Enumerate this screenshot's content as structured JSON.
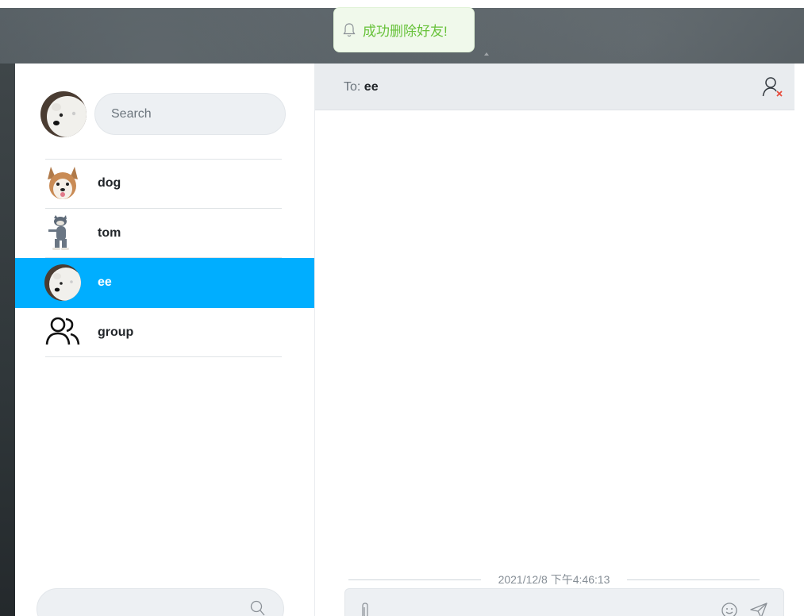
{
  "toast": {
    "message": "成功删除好友!",
    "icon": "bell-icon",
    "color": "#67c23a"
  },
  "sidebar": {
    "search": {
      "placeholder": "Search"
    },
    "contacts": [
      {
        "name": "dog",
        "avatar": "husky-dog-avatar",
        "active": false
      },
      {
        "name": "tom",
        "avatar": "tom-cat-avatar",
        "active": false
      },
      {
        "name": "ee",
        "avatar": "ice-bear-avatar",
        "active": true
      },
      {
        "name": "group",
        "avatar": "group-icon",
        "active": false
      }
    ],
    "bottom_search_icon": "search-icon"
  },
  "chat": {
    "to_label": "To: ",
    "recipient": "ee",
    "remove_friend_icon": "remove-user-icon",
    "timestamp": "2021/12/8 下午4:46:13",
    "composer_icons": [
      "paperclip-icon",
      "emoji-icon",
      "send-icon"
    ]
  },
  "colors": {
    "active_contact": "#00aeff",
    "header_bg": "#e9ecef",
    "input_bg": "#edf0f3",
    "remove_x": "#e74c3c"
  }
}
